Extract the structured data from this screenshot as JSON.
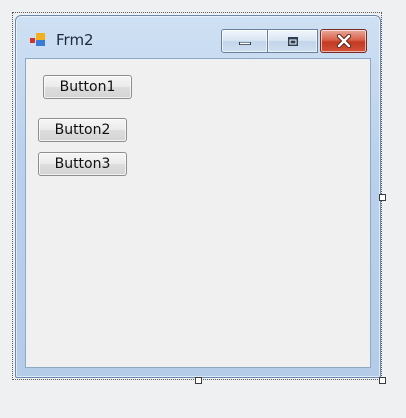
{
  "form": {
    "title": "Frm2",
    "icon": "form-app-icon",
    "caption_buttons": {
      "minimize_icon": "minimize-icon",
      "maximize_icon": "maximize-icon",
      "close_icon": "close-icon"
    },
    "buttons": [
      {
        "label": "Button1"
      },
      {
        "label": "Button2"
      },
      {
        "label": "Button3"
      }
    ]
  },
  "colors": {
    "frame_blue": "#b9d1ec",
    "close_red": "#c23a22",
    "client_bg": "#f0f0f0"
  }
}
